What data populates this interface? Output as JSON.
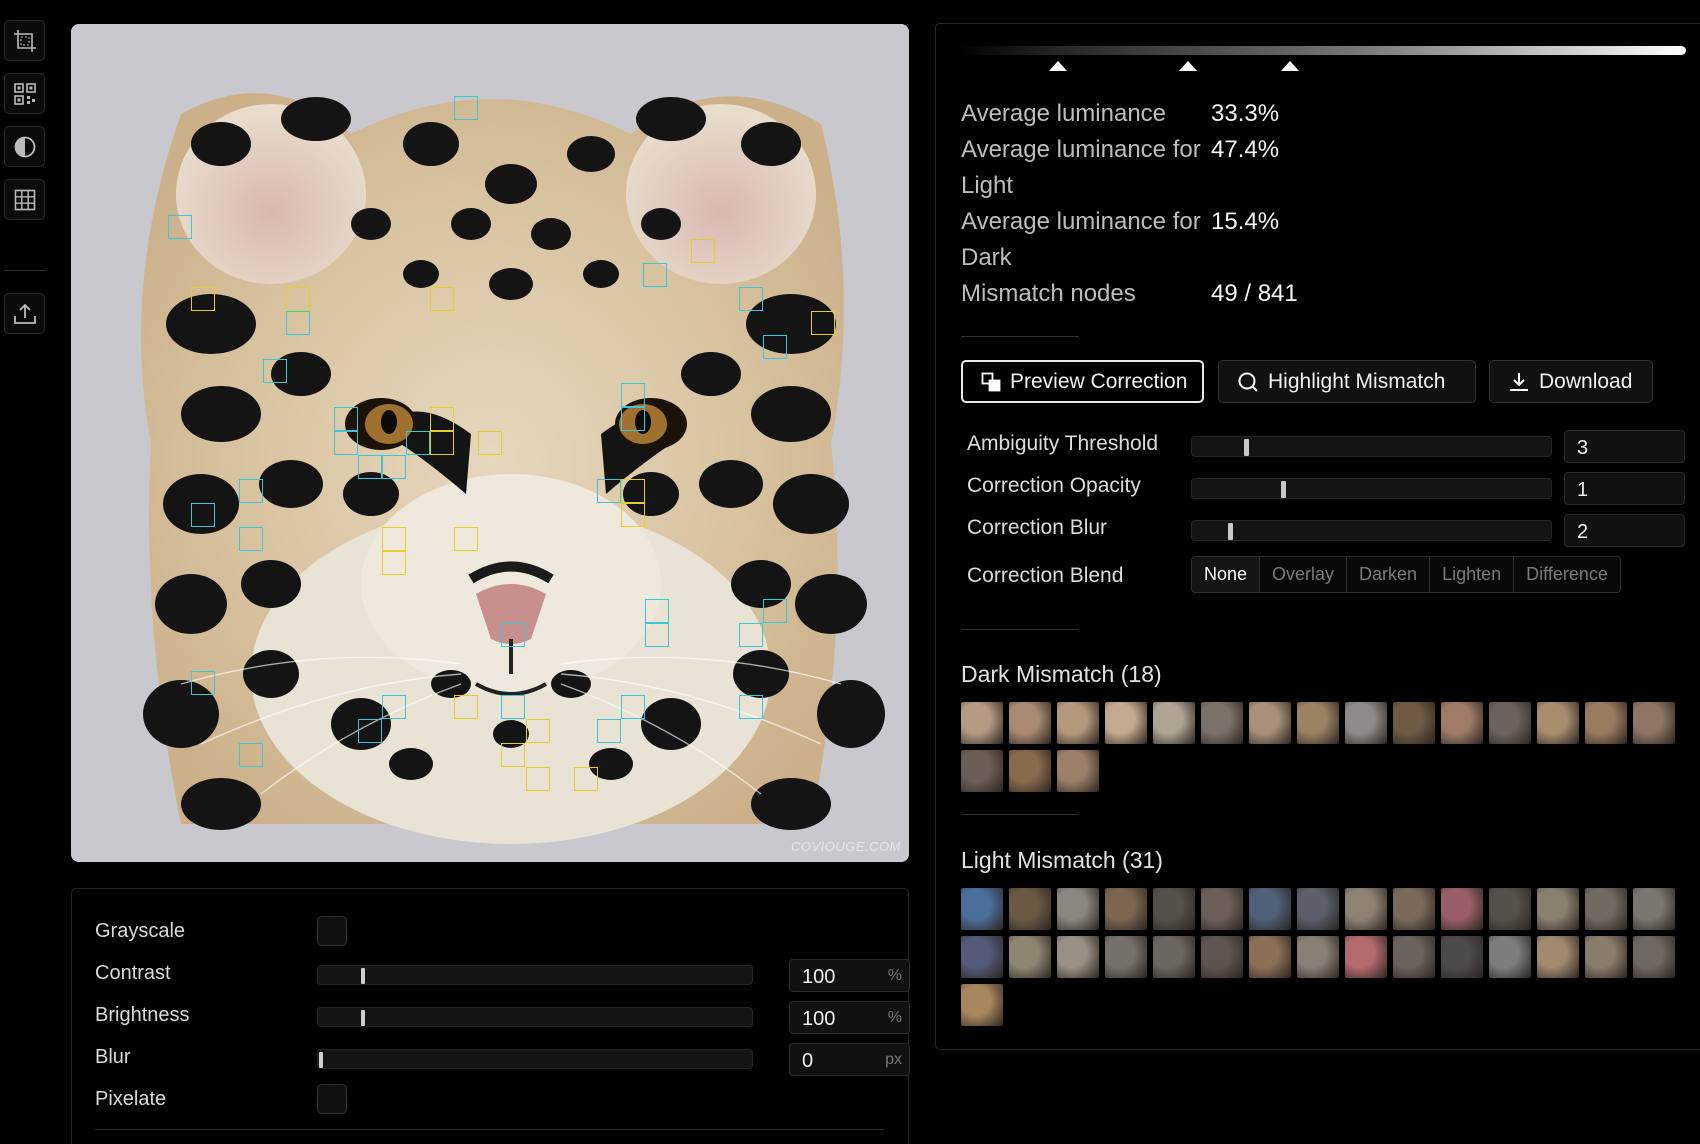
{
  "toolbar": {
    "tools": [
      {
        "name": "crop-icon"
      },
      {
        "name": "qr-code-icon"
      },
      {
        "name": "contrast-icon"
      },
      {
        "name": "grid-icon"
      },
      {
        "name": "export-icon"
      }
    ]
  },
  "image": {
    "watermark": "COVIOUGE.COM",
    "nodes_light": 31,
    "nodes_dark": 18
  },
  "adjustments": {
    "grayscale_label": "Grayscale",
    "contrast_label": "Contrast",
    "contrast_value": "100",
    "contrast_unit": "%",
    "brightness_label": "Brightness",
    "brightness_value": "100",
    "brightness_unit": "%",
    "blur_label": "Blur",
    "blur_value": "0",
    "blur_unit": "px",
    "pixelate_label": "Pixelate"
  },
  "stats": {
    "avg_luminance_label": "Average luminance",
    "avg_luminance_value": "33.3%",
    "avg_light_label": "Average luminance for Light",
    "avg_light_value": "47.4%",
    "avg_dark_label": "Average luminance for Dark",
    "avg_dark_value": "15.4%",
    "mismatch_label": "Mismatch nodes",
    "mismatch_value": "49 / 841"
  },
  "actions": {
    "preview_label": "Preview Correction",
    "highlight_label": "Highlight Mismatch",
    "download_label": "Download"
  },
  "controls": {
    "ambiguity_label": "Ambiguity Threshold",
    "ambiguity_value": "3",
    "opacity_label": "Correction Opacity",
    "opacity_value": "1",
    "blur_label": "Correction Blur",
    "blur_value": "2",
    "blend_label": "Correction Blend",
    "blend_options": [
      "None",
      "Overlay",
      "Darken",
      "Lighten",
      "Difference"
    ],
    "blend_selected": "None"
  },
  "dark_mismatch": {
    "title": "Dark Mismatch (18)",
    "count": 18
  },
  "light_mismatch": {
    "title": "Light Mismatch (31)",
    "count": 31
  },
  "colors": {
    "light_node": "#3fc6d6",
    "dark_node": "#e3cf2a",
    "background": "#000000"
  }
}
